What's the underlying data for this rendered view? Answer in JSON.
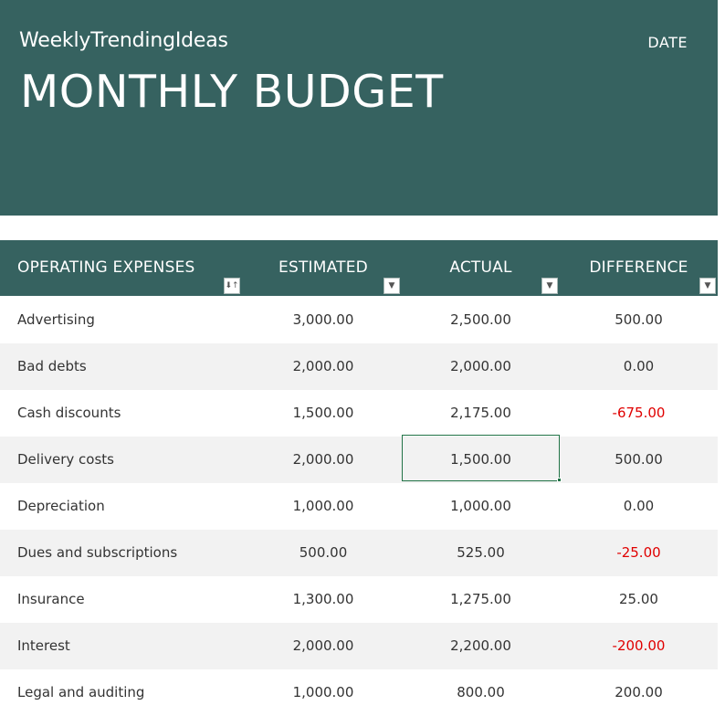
{
  "header": {
    "brand": "WeeklyTrendingIdeas",
    "date_label": "DATE",
    "title": "MONTHLY BUDGET"
  },
  "colors": {
    "banner": "#366260",
    "negative": "#e00000",
    "selection": "#217346",
    "alt_row": "#f2f2f2"
  },
  "table": {
    "columns": [
      "OPERATING EXPENSES",
      "ESTIMATED",
      "ACTUAL",
      "DIFFERENCE"
    ],
    "filter_icons": [
      "sort-filter-icon",
      "dropdown-icon",
      "dropdown-icon",
      "dropdown-icon"
    ],
    "rows": [
      {
        "expense": "Advertising",
        "estimated": "3,000.00",
        "actual": "2,500.00",
        "difference": "500.00"
      },
      {
        "expense": "Bad debts",
        "estimated": "2,000.00",
        "actual": "2,000.00",
        "difference": "0.00"
      },
      {
        "expense": "Cash discounts",
        "estimated": "1,500.00",
        "actual": "2,175.00",
        "difference": "-675.00"
      },
      {
        "expense": "Delivery costs",
        "estimated": "2,000.00",
        "actual": "1,500.00",
        "difference": "500.00"
      },
      {
        "expense": "Depreciation",
        "estimated": "1,000.00",
        "actual": "1,000.00",
        "difference": "0.00"
      },
      {
        "expense": "Dues and subscriptions",
        "estimated": "500.00",
        "actual": "525.00",
        "difference": "-25.00"
      },
      {
        "expense": "Insurance",
        "estimated": "1,300.00",
        "actual": "1,275.00",
        "difference": "25.00"
      },
      {
        "expense": "Interest",
        "estimated": "2,000.00",
        "actual": "2,200.00",
        "difference": "-200.00"
      },
      {
        "expense": "Legal and auditing",
        "estimated": "1,000.00",
        "actual": "800.00",
        "difference": "200.00"
      }
    ]
  }
}
